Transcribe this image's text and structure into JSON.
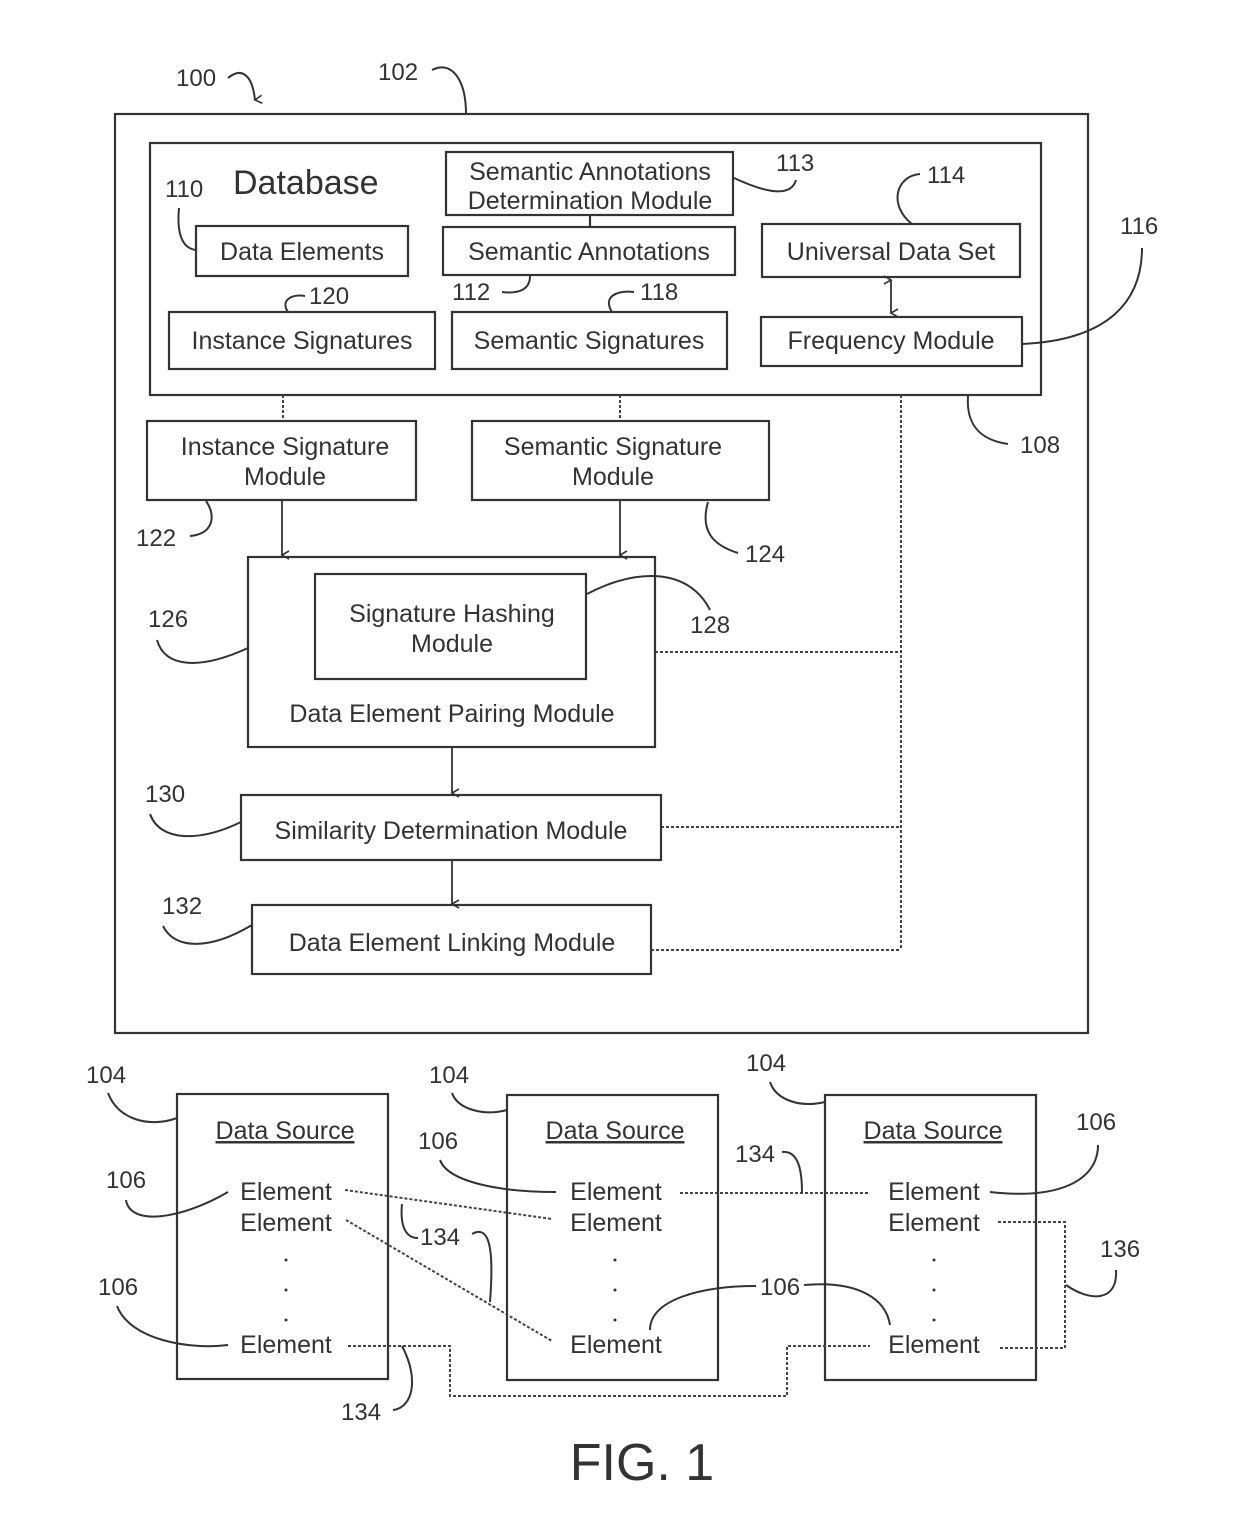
{
  "figure": {
    "title": "FIG. 1",
    "refs": {
      "system": "100",
      "server": "102",
      "data_source": "104",
      "element": "106",
      "database": "108",
      "data_elements": "110",
      "semantic_annotations": "112",
      "semantic_annotations_determination_module": "113",
      "universal_data_set": "114",
      "frequency_module": "116",
      "semantic_signatures": "118",
      "instance_signatures": "120",
      "instance_signature_module": "122",
      "semantic_signature_module": "124",
      "data_element_pairing_module": "126",
      "signature_hashing_module": "128",
      "similarity_determination_module": "130",
      "data_element_linking_module": "132",
      "link": "134",
      "link_within_source": "136"
    },
    "database": {
      "title": "Database",
      "data_elements": "Data Elements",
      "sadm_line1": "Semantic Annotations",
      "sadm_line2": "Determination Module",
      "semantic_annotations": "Semantic Annotations",
      "universal_data_set": "Universal Data Set",
      "instance_signatures": "Instance Signatures",
      "semantic_signatures": "Semantic Signatures",
      "frequency_module": "Frequency Module"
    },
    "modules": {
      "instance_signature_line1": "Instance Signature",
      "instance_signature_line2": "Module",
      "semantic_signature_line1": "Semantic Signature",
      "semantic_signature_line2": "Module",
      "hashing_line1": "Signature Hashing",
      "hashing_line2": "Module",
      "pairing": "Data Element Pairing Module",
      "similarity": "Similarity Determination Module",
      "linking": "Data Element Linking Module"
    },
    "data_sources": [
      {
        "title": "Data Source",
        "elements": [
          "Element",
          "Element",
          "Element"
        ]
      },
      {
        "title": "Data Source",
        "elements": [
          "Element",
          "Element",
          "Element"
        ]
      },
      {
        "title": "Data Source",
        "elements": [
          "Element",
          "Element",
          "Element"
        ]
      }
    ],
    "ellipsis": "."
  }
}
